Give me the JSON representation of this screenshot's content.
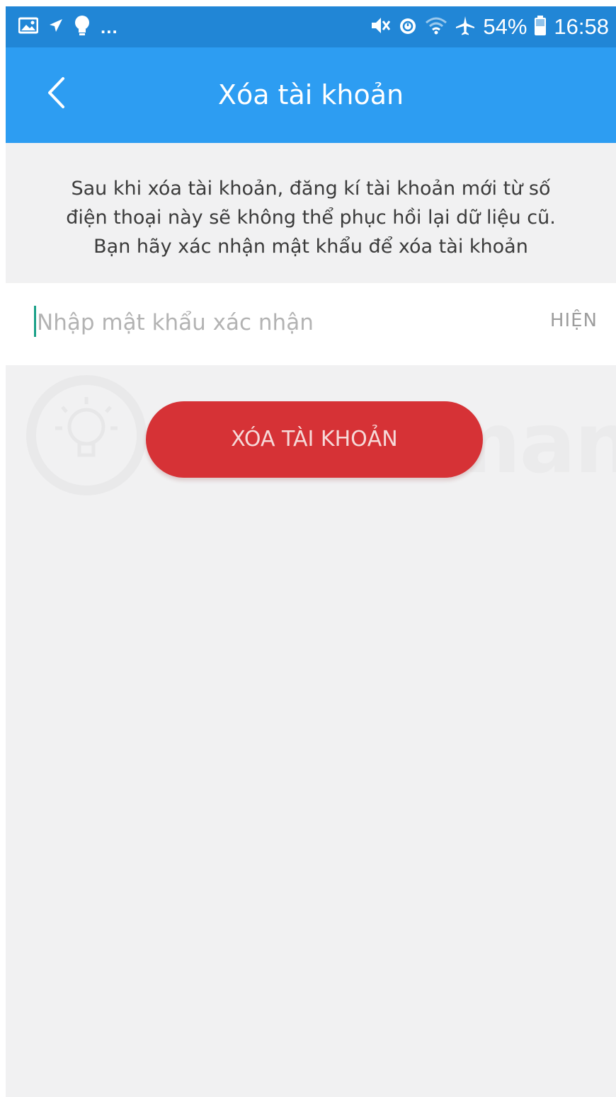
{
  "status_bar": {
    "notification_icons": [
      "image-icon",
      "send-icon",
      "lightbulb-icon"
    ],
    "overflow": "...",
    "system_icons": [
      "mute-icon",
      "alarm-icon",
      "wifi-icon",
      "airplane-icon"
    ],
    "battery_percent": "54%",
    "time": "16:58",
    "color": "#2186d6"
  },
  "header": {
    "title": "Xóa tài khoản",
    "back_icon": "chevron-left-icon",
    "color": "#2d9df2"
  },
  "info": {
    "text": "Sau khi xóa tài khoản, đăng kí tài khoản mới từ số\nđiện thoại này sẽ không thể phục hồi lại dữ liệu cũ.\nBạn hãy xác nhận mật khẩu để xóa tài khoản"
  },
  "password": {
    "value": "",
    "placeholder": "Nhập mật khẩu xác nhận",
    "toggle_label": "HIỆN"
  },
  "actions": {
    "delete_label": "XÓA TÀI KHOẢN",
    "delete_color": "#d63236"
  },
  "watermark": {
    "text": "uantrimang",
    "icon": "lightbulb-icon"
  }
}
